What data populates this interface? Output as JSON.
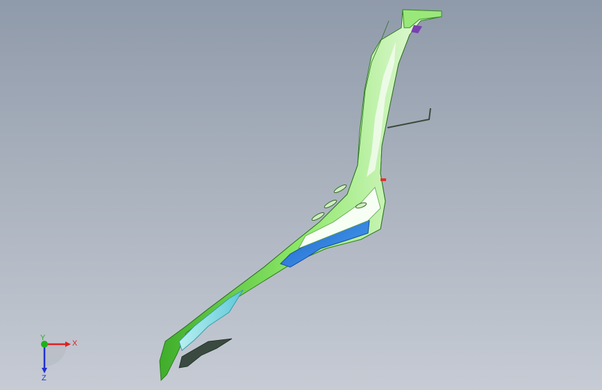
{
  "triad": {
    "x_label": "X",
    "y_label": "Y",
    "z_label": "Z",
    "x_color": "#e02020",
    "y_color": "#20b020",
    "z_color": "#2030d0"
  },
  "model": {
    "part_colors": {
      "main_body": "#7ee05a",
      "highlight": "#eafae2",
      "blue_panel": "#2b7fe0",
      "cyan_panel": "#8ae6e0",
      "accent_purple": "#7a3fb0",
      "accent_red": "#e03030"
    }
  }
}
